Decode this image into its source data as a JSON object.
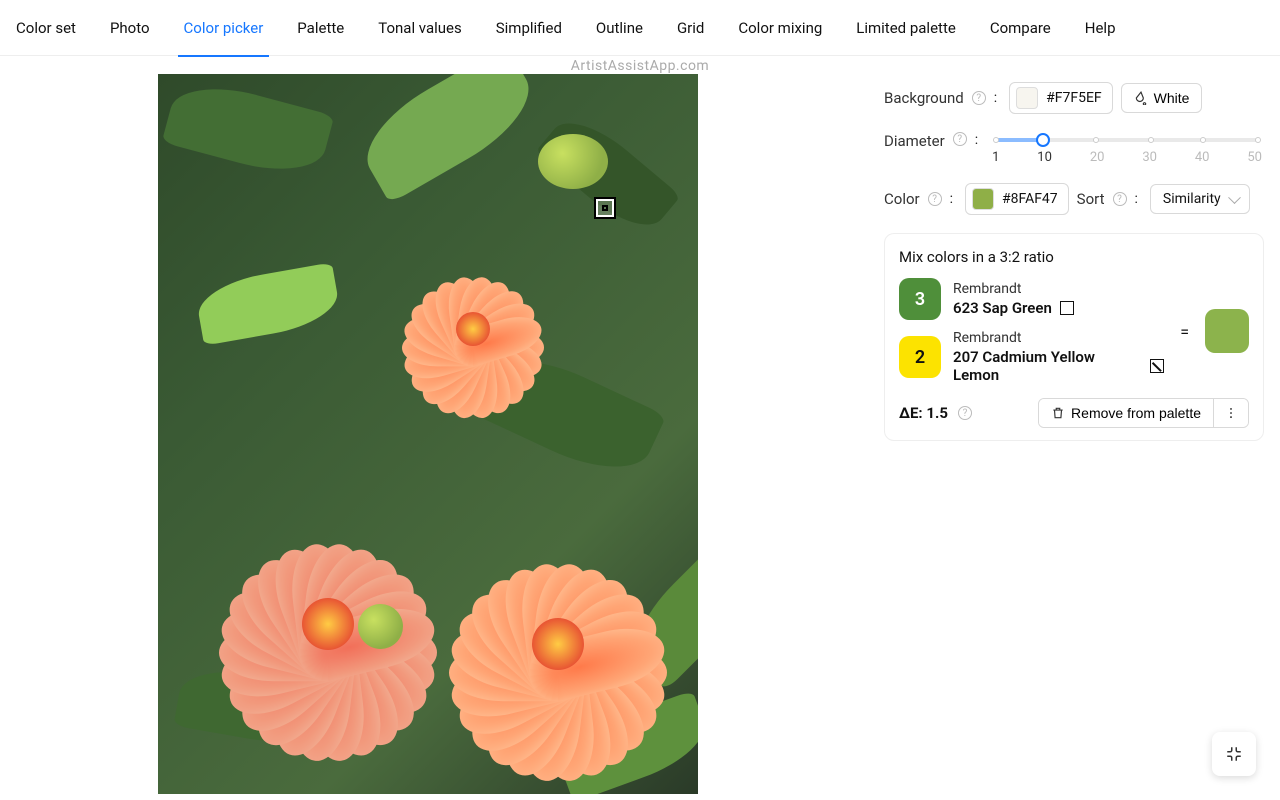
{
  "watermark": "ArtistAssistApp.com",
  "tabs": {
    "items": [
      "Color set",
      "Photo",
      "Color picker",
      "Palette",
      "Tonal values",
      "Simplified",
      "Outline",
      "Grid",
      "Color mixing",
      "Limited palette",
      "Compare",
      "Help"
    ],
    "active_index": 2
  },
  "panel": {
    "background": {
      "label": "Background",
      "hex": "#F7F5EF",
      "white_button": "White"
    },
    "diameter": {
      "label": "Diameter",
      "value": 10,
      "marks": [
        1,
        10,
        20,
        30,
        40,
        50
      ]
    },
    "color": {
      "label": "Color",
      "hex": "#8FAF47"
    },
    "sort": {
      "label": "Sort",
      "value": "Similarity"
    }
  },
  "mix": {
    "title": "Mix colors in a 3:2 ratio",
    "pairs": [
      {
        "ratio": 3,
        "chip_color": "#4F8F3A",
        "brand": "Rembrandt",
        "name": "623 Sap Green",
        "opacity": "opaque"
      },
      {
        "ratio": 2,
        "chip_color": "#FCE300",
        "chip_text_color": "#111",
        "brand": "Rembrandt",
        "name": "207 Cadmium Yellow Lemon",
        "opacity": "semi"
      }
    ],
    "equals": "=",
    "result_color": "#8CB34C",
    "deltaE_label": "ΔE:",
    "deltaE_value": "1.5",
    "remove_label": "Remove from palette"
  },
  "colon": ":"
}
